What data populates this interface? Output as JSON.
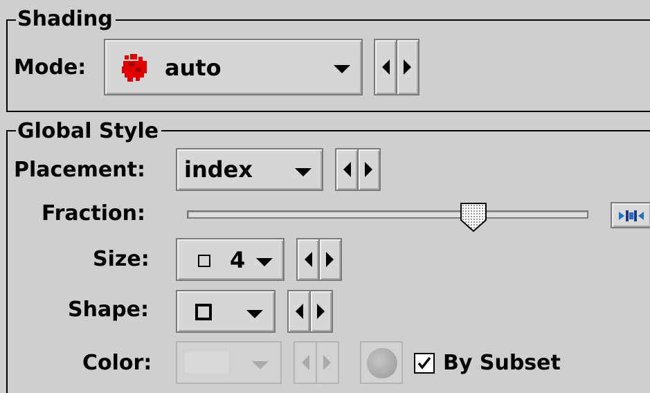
{
  "shading": {
    "legend": "Shading",
    "mode_label": "Mode:",
    "mode_value": "auto",
    "mode_icon": "red-splat-icon",
    "mode_icon_color": "#e00000"
  },
  "global_style": {
    "legend": "Global Style",
    "placement_label": "Placement:",
    "placement_value": "index",
    "fraction_label": "Fraction:",
    "fraction_value": 0.73,
    "size_label": "Size:",
    "size_value": "4",
    "size_icon": "small-square-icon",
    "shape_label": "Shape:",
    "shape_icon": "open-square-icon",
    "color_label": "Color:",
    "color_enabled": false,
    "by_subset_label": "By Subset",
    "by_subset_checked": true
  }
}
